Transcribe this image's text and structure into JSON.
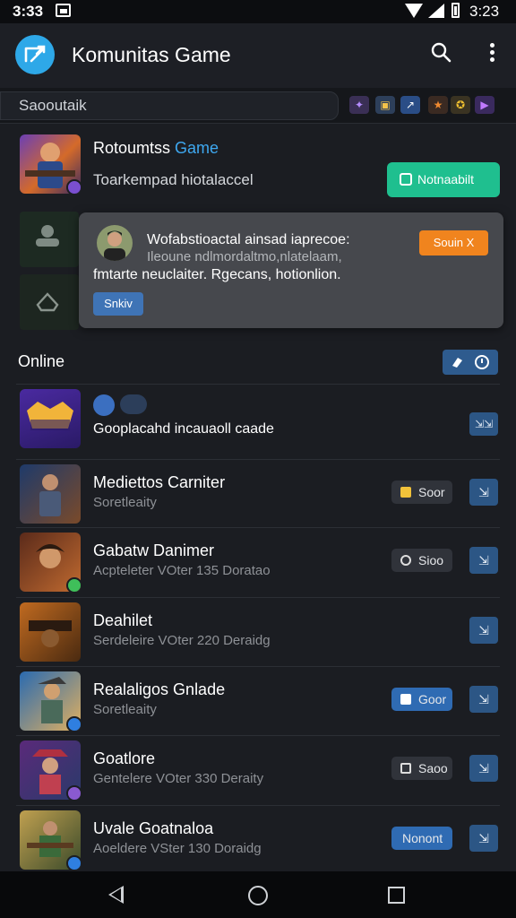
{
  "status_bar": {
    "time_left": "3:33",
    "time_right": "3:23"
  },
  "app": {
    "title": "Komunitas Game"
  },
  "search": {
    "value": "Saooutaik",
    "placeholder": "Saooutaik"
  },
  "featured": {
    "title_main": "Rotoumtss ",
    "title_accent": "Game",
    "subtitle": "Toarkempad hiotalaccel",
    "notify_label": "Notnaabilt"
  },
  "toast": {
    "line1": "Wofabstioactal ainsad iaprecoe:",
    "line2": "Ileoune ndlmordaltmo,nlatelaam,",
    "line3": "fmtarte neuclaiter. Rgecans, hotionlion.",
    "action_label": "Souin X",
    "show_label": "Snkiv"
  },
  "online": {
    "title": "Online",
    "first_row_text": "Gooplacahd incauaoll caade"
  },
  "games": [
    {
      "name": "Mediettos Carniter",
      "meta": "Soretleaity",
      "status": "Soor",
      "status_style": "dark"
    },
    {
      "name": "Gabatw Danimer",
      "meta": "Acpteleter VOter 135 Doratao",
      "status": "Sioo",
      "status_style": "dark"
    },
    {
      "name": "Deahilet",
      "meta": "Serdeleire VOter 220 Deraidg",
      "status": "",
      "status_style": "none"
    },
    {
      "name": "Realaligos Gnlade",
      "meta": "Soretleaity",
      "status": "Goor",
      "status_style": "blue"
    },
    {
      "name": "Goatlore",
      "meta": "Gentelere VOter 330 Deraity",
      "status": "Saoo",
      "status_style": "dark"
    },
    {
      "name": "Uvale Goatnaloa",
      "meta": "Aoeldere VSter 130 Doraidg",
      "status": "Nonont",
      "status_style": "blue"
    }
  ],
  "action_glyph": "⇲",
  "first_action_glyph": "⇲⇲",
  "colors": {
    "accent_blue": "#3ea8f0",
    "notify_green": "#1fbf8f",
    "toast_orange": "#f0841e"
  }
}
